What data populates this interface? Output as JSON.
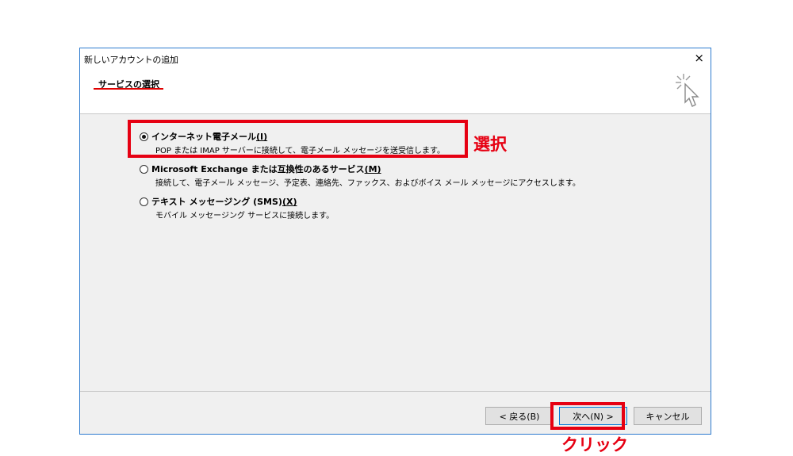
{
  "dialog": {
    "title": "新しいアカウントの追加",
    "close_symbol": "×",
    "section_title": "サービスの選択",
    "wizard_icon": "cursor-click-icon"
  },
  "options": [
    {
      "label": "インターネット電子メール",
      "accel": "(I)",
      "description": "POP または IMAP サーバーに接続して、電子メール メッセージを送受信します。",
      "checked": true
    },
    {
      "label": "Microsoft Exchange または互換性のあるサービス",
      "accel": "(M)",
      "description": "接続して、電子メール メッセージ、予定表、連絡先、ファックス、およびボイス メール メッセージにアクセスします。",
      "checked": false
    },
    {
      "label": "テキスト メッセージング (SMS)",
      "accel": "(X)",
      "description": "モバイル メッセージング サービスに接続します。",
      "checked": false
    }
  ],
  "buttons": {
    "back": "< 戻る(B)",
    "next": "次へ(N) >",
    "cancel": "キャンセル"
  },
  "annotations": {
    "select": "選択",
    "click": "クリック",
    "color": "#e60012"
  }
}
